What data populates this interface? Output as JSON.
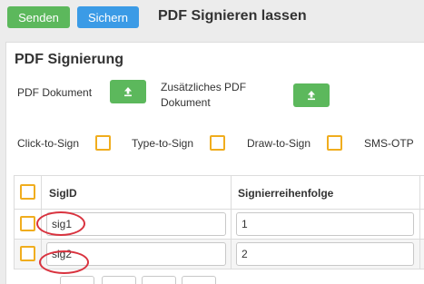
{
  "toolbar": {
    "send_label": "Senden",
    "save_label": "Sichern",
    "title": "PDF Signieren lassen"
  },
  "panel": {
    "title": "PDF Signierung",
    "pdf_document_label": "PDF Dokument",
    "additional_pdf_label_line1": "Zusätzliches PDF",
    "additional_pdf_label_line2": "Dokument"
  },
  "sign_options": [
    {
      "label": "Click-to-Sign",
      "checked": false
    },
    {
      "label": "Type-to-Sign",
      "checked": false
    },
    {
      "label": "Draw-to-Sign",
      "checked": false
    },
    {
      "label": "SMS-OTP",
      "checked": false
    }
  ],
  "table": {
    "columns": [
      "SigID",
      "Signierreihenfolge"
    ],
    "rows": [
      {
        "sig_id": "sig1",
        "order": "1"
      },
      {
        "sig_id": "sig2",
        "order": "2"
      }
    ]
  },
  "colors": {
    "send": "#5cb85c",
    "save": "#3b9be6",
    "checkbox_border": "#f0ad1e",
    "highlight": "#d9333f"
  },
  "icons": [
    "upload-icon",
    "upload-icon"
  ]
}
